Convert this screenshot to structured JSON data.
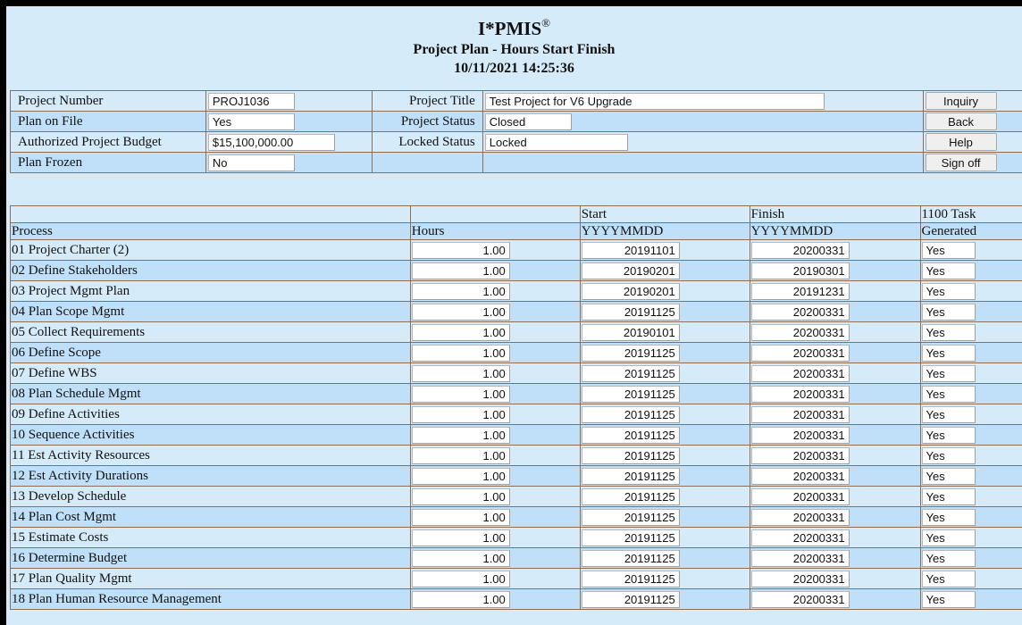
{
  "header": {
    "app_name": "I*PMIS",
    "app_mark": "®",
    "page_title": "Project Plan - Hours Start Finish",
    "datetime": "10/11/2021 14:25:36"
  },
  "info": {
    "project_number": {
      "label": "Project Number",
      "value": "PROJ1036"
    },
    "plan_on_file": {
      "label": "Plan on File",
      "value": "Yes"
    },
    "authorized_budget": {
      "label": "Authorized Project Budget",
      "value": "$15,100,000.00"
    },
    "plan_frozen": {
      "label": "Plan Frozen",
      "value": "No"
    },
    "project_title": {
      "label": "Project Title",
      "value": "Test Project for V6 Upgrade"
    },
    "project_status": {
      "label": "Project Status",
      "value": "Closed"
    },
    "locked_status": {
      "label": "Locked Status",
      "value": "Locked"
    }
  },
  "buttons": {
    "inquiry": "Inquiry",
    "back": "Back",
    "help": "Help",
    "sign_off": "Sign off"
  },
  "grid": {
    "headers": {
      "process_top": "",
      "hours_top": "",
      "start_top": "Start",
      "finish_top": "Finish",
      "task_top": "1100 Task",
      "process": "Process",
      "hours": "Hours",
      "start": "YYYYMMDD",
      "finish": "YYYYMMDD",
      "task": "Generated"
    },
    "rows": [
      {
        "process": "01  Project Charter (2)",
        "hours": "1.00",
        "start": "20191101",
        "finish": "20200331",
        "generated": "Yes"
      },
      {
        "process": "02  Define Stakeholders",
        "hours": "1.00",
        "start": "20190201",
        "finish": "20190301",
        "generated": "Yes"
      },
      {
        "process": "03  Project Mgmt Plan",
        "hours": "1.00",
        "start": "20190201",
        "finish": "20191231",
        "generated": "Yes"
      },
      {
        "process": "04  Plan Scope Mgmt",
        "hours": "1.00",
        "start": "20191125",
        "finish": "20200331",
        "generated": "Yes"
      },
      {
        "process": "05  Collect Requirements",
        "hours": "1.00",
        "start": "20190101",
        "finish": "20200331",
        "generated": "Yes"
      },
      {
        "process": "06  Define Scope",
        "hours": "1.00",
        "start": "20191125",
        "finish": "20200331",
        "generated": "Yes"
      },
      {
        "process": "07  Define WBS",
        "hours": "1.00",
        "start": "20191125",
        "finish": "20200331",
        "generated": "Yes"
      },
      {
        "process": "08  Plan Schedule Mgmt",
        "hours": "1.00",
        "start": "20191125",
        "finish": "20200331",
        "generated": "Yes"
      },
      {
        "process": "09  Define Activities",
        "hours": "1.00",
        "start": "20191125",
        "finish": "20200331",
        "generated": "Yes"
      },
      {
        "process": "10  Sequence Activities",
        "hours": "1.00",
        "start": "20191125",
        "finish": "20200331",
        "generated": "Yes"
      },
      {
        "process": "11  Est Activity Resources",
        "hours": "1.00",
        "start": "20191125",
        "finish": "20200331",
        "generated": "Yes"
      },
      {
        "process": "12  Est Activity Durations",
        "hours": "1.00",
        "start": "20191125",
        "finish": "20200331",
        "generated": "Yes"
      },
      {
        "process": "13  Develop Schedule",
        "hours": "1.00",
        "start": "20191125",
        "finish": "20200331",
        "generated": "Yes"
      },
      {
        "process": "14  Plan Cost Mgmt",
        "hours": "1.00",
        "start": "20191125",
        "finish": "20200331",
        "generated": "Yes"
      },
      {
        "process": "15  Estimate Costs",
        "hours": "1.00",
        "start": "20191125",
        "finish": "20200331",
        "generated": "Yes"
      },
      {
        "process": "16  Determine Budget",
        "hours": "1.00",
        "start": "20191125",
        "finish": "20200331",
        "generated": "Yes"
      },
      {
        "process": "17  Plan Quality Mgmt",
        "hours": "1.00",
        "start": "20191125",
        "finish": "20200331",
        "generated": "Yes"
      },
      {
        "process": "18  Plan Human Resource Management",
        "hours": "1.00",
        "start": "20191125",
        "finish": "20200331",
        "generated": "Yes"
      }
    ]
  }
}
